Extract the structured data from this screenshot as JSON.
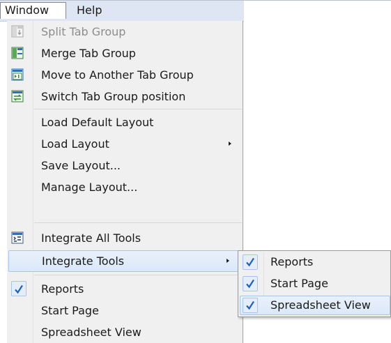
{
  "menubar": {
    "items": [
      {
        "label": "Window"
      },
      {
        "label": "Help"
      }
    ]
  },
  "window_menu": {
    "items": [
      {
        "label": "Split Tab Group",
        "icon": "split-tab-group-icon",
        "enabled": false
      },
      {
        "label": "Merge Tab Group",
        "icon": "merge-tab-group-icon"
      },
      {
        "label": "Move to Another Tab Group",
        "icon": "move-tab-group-icon"
      },
      {
        "label": "Switch Tab Group position",
        "icon": "switch-tab-group-icon"
      },
      {
        "label": "Load Default Layout"
      },
      {
        "label": "Load Layout",
        "has_submenu": true
      },
      {
        "label": "Save Layout..."
      },
      {
        "label": "Manage Layout..."
      },
      {
        "label": "Integrate All Tools",
        "icon": "integrate-tools-icon"
      },
      {
        "label": "Integrate Tools",
        "has_submenu": true,
        "highlighted": true
      },
      {
        "label": "Reports",
        "checked": true
      },
      {
        "label": "Start Page"
      },
      {
        "label": "Spreadsheet View"
      }
    ]
  },
  "integrate_tools_submenu": {
    "items": [
      {
        "label": "Reports",
        "checked": true
      },
      {
        "label": "Start Page",
        "checked": true
      },
      {
        "label": "Spreadsheet View",
        "checked": true,
        "highlighted": true
      }
    ]
  },
  "colors": {
    "menu_bg": "#f0f0f0",
    "highlight": "#dbe8f8",
    "check": "#1f5fbf",
    "disabled_text": "#8d8d8d"
  }
}
